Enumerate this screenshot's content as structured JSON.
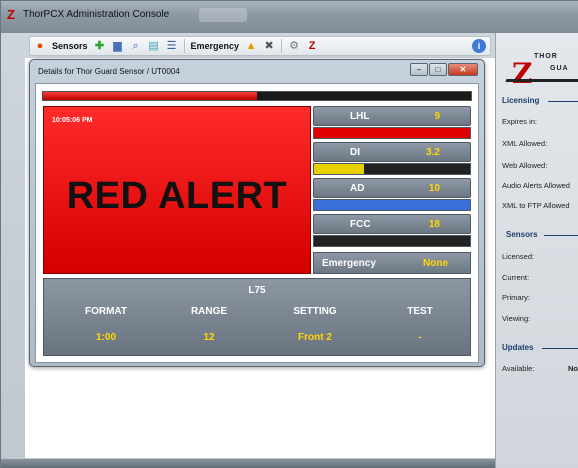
{
  "app": {
    "title": "ThorPCX Administration Console"
  },
  "toolbar": {
    "sensors_label": "Sensors",
    "emergency_label": "Emergency",
    "icons": [
      "sensor-icon",
      "add-icon",
      "monitor-icon",
      "search-icon",
      "report-icon",
      "list-icon",
      "warning-icon",
      "tools-icon",
      "gear-icon",
      "thor-z-icon",
      "info-icon"
    ]
  },
  "details": {
    "title": "Details for Thor Guard Sensor / UT0004",
    "progress_fraction": 0.5,
    "alert": {
      "time": "10:05:06 PM",
      "text": "RED ALERT",
      "color": "#e60000"
    },
    "rows": [
      {
        "name": "LHL",
        "value": "9",
        "bar_color": "#e00000",
        "fraction": 1.0
      },
      {
        "name": "DI",
        "value": "3.2",
        "bar_color": "#e6d000",
        "fraction": 0.32
      },
      {
        "name": "AD",
        "value": "10",
        "bar_color": "#3a6fd8",
        "fraction": 1.0
      },
      {
        "name": "FCC",
        "value": "18",
        "bar_color": "#222222",
        "fraction": 0.0
      }
    ],
    "emergency": {
      "label": "Emergency",
      "value": "None"
    },
    "info": {
      "title": "L75",
      "columns": [
        {
          "label": "FORMAT",
          "value": "1:00"
        },
        {
          "label": "RANGE",
          "value": "12"
        },
        {
          "label": "SETTING",
          "value": "Front 2"
        },
        {
          "label": "TEST",
          "value": "-"
        }
      ]
    }
  },
  "sidebar": {
    "brand": {
      "thor": "THOR",
      "guard": "GUA"
    },
    "licensing": {
      "heading": "Licensing",
      "items": [
        "Expires in:",
        "XML Allowed:",
        "Web Allowed:",
        "Audio Alerts Allowed",
        "XML to FTP Allowed"
      ]
    },
    "sensors": {
      "heading": "Sensors",
      "items": [
        "Licensed:",
        "Current:",
        "Primary:",
        "Viewing:"
      ]
    },
    "updates": {
      "heading": "Updates",
      "items": [
        "Available:"
      ],
      "available_value": "No"
    }
  }
}
